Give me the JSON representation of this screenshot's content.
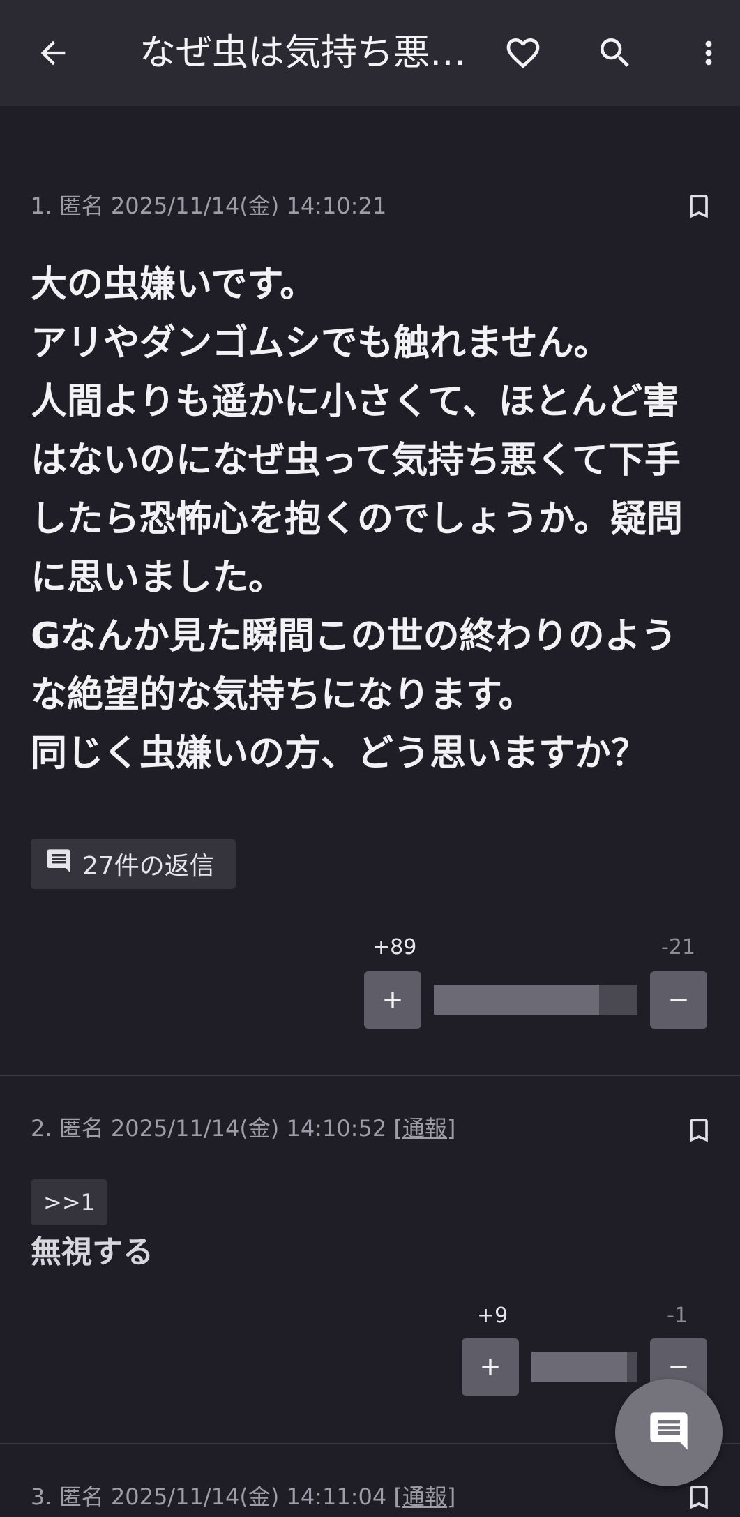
{
  "appbar": {
    "title": "なぜ虫は気持ち悪…",
    "icons": [
      "back-arrow-icon",
      "heart-icon",
      "search-icon",
      "more-vert-icon"
    ]
  },
  "posts": [
    {
      "meta": "1. 匿名 2025/11/14(金) 14:10:21",
      "body_lines": [
        "大の虫嫌いです。",
        "アリやダンゴムシでも触れません。",
        "人間よりも遥かに小さくて、ほとんど害",
        "はないのになぜ虫って気持ち悪くて下手",
        "したら恐怖心を抱くのでしょうか。疑問",
        "に思いました。",
        "Gなんか見た瞬間この世の終わりのよう",
        "な絶望的な気持ちになります。",
        "同じく虫嫌いの方、どう思いますか？"
      ],
      "replies_label": "27件の返信",
      "plus": "+89",
      "minus": "-21",
      "plus_ratio": 0.81
    },
    {
      "meta": "2. 匿名 2025/11/14(金) 14:10:52 ",
      "report": "[通報]",
      "anchor": ">>1",
      "body": "無視する",
      "plus": "+9",
      "minus": "-1",
      "plus_ratio": 0.9
    },
    {
      "meta": "3. 匿名 2025/11/14(金) 14:11:04 ",
      "report": "[通報]"
    }
  ],
  "colors": {
    "background": "#1f1e27",
    "appbar": "#2b2a33",
    "button": "#5f5e68"
  }
}
